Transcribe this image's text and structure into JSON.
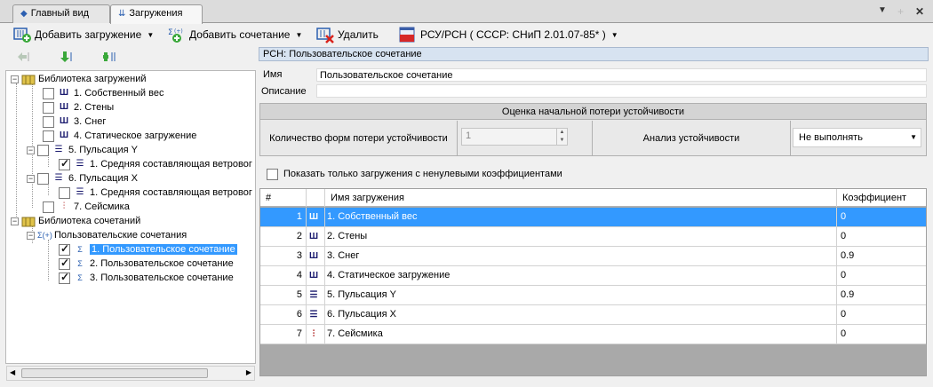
{
  "tabs": [
    {
      "label": "Главный вид",
      "icon": "pin-icon"
    },
    {
      "label": "Загружения",
      "icon": "loads-icon",
      "active": true
    }
  ],
  "tab_controls": {
    "dropdown": "▼",
    "add": "+",
    "close": "✕"
  },
  "toolbar": {
    "add_load": "Добавить загружение",
    "add_combo": "Добавить сочетание",
    "delete": "Удалить",
    "norm": "РСУ/РСН ( СССР: СНиП 2.01.07-85* )"
  },
  "tree": {
    "root_loads": "Библиотека загружений",
    "loads": [
      {
        "label": "1. Собственный вес",
        "icon": "static-load-icon",
        "checked": false
      },
      {
        "label": "2. Стены",
        "icon": "static-load-icon",
        "checked": false
      },
      {
        "label": "3. Снег",
        "icon": "static-load-icon",
        "checked": false
      },
      {
        "label": "4. Статическое загружение",
        "icon": "static-load-icon",
        "checked": false
      },
      {
        "label": "5. Пульсация Y",
        "icon": "pulsation-icon",
        "checked": false,
        "expanded": true,
        "child": {
          "label": "1. Средняя составляющая ветровог",
          "checked": true
        }
      },
      {
        "label": "6. Пульсация X",
        "icon": "pulsation-icon",
        "checked": false,
        "expanded": true,
        "child": {
          "label": "1. Средняя составляющая ветровог",
          "checked": false
        }
      },
      {
        "label": "7. Сейсмика",
        "icon": "seismic-icon",
        "checked": false
      }
    ],
    "root_combos": "Библиотека сочетаний",
    "user_combos_group": "Пользовательские сочетания",
    "combos": [
      {
        "label": "1. Пользовательское сочетание",
        "checked": true,
        "selected": true
      },
      {
        "label": "2. Пользовательское сочетание",
        "checked": true
      },
      {
        "label": "3. Пользовательское сочетание",
        "checked": true
      }
    ]
  },
  "right": {
    "header": "РСН: Пользовательское сочетание",
    "name_label": "Имя",
    "name_value": "Пользовательское сочетание",
    "desc_label": "Описание",
    "desc_value": "",
    "stability": {
      "title": "Оценка начальной потери устойчивости",
      "modes_label": "Количество форм потери устойчивости",
      "modes_value": "1",
      "analysis_label": "Анализ устойчивости",
      "analysis_value": "Не выполнять"
    },
    "filter_label": "Показать только загружения с ненулевыми коэффициентами"
  },
  "grid": {
    "headers": [
      "#",
      "Имя загружения",
      "Коэффициент"
    ],
    "rows": [
      {
        "num": "1",
        "icon": "static-load-icon",
        "name": "1. Собственный вес",
        "coef": "0",
        "selected": true
      },
      {
        "num": "2",
        "icon": "static-load-icon",
        "name": "2. Стены",
        "coef": "0"
      },
      {
        "num": "3",
        "icon": "static-load-icon",
        "name": "3. Снег",
        "coef": "0.9"
      },
      {
        "num": "4",
        "icon": "static-load-icon",
        "name": "4. Статическое загружение",
        "coef": "0"
      },
      {
        "num": "5",
        "icon": "pulsation-icon",
        "name": "5. Пульсация Y",
        "coef": "0.9"
      },
      {
        "num": "6",
        "icon": "pulsation-icon",
        "name": "6. Пульсация X",
        "coef": "0"
      },
      {
        "num": "7",
        "icon": "seismic-icon",
        "name": "7. Сейсмика",
        "coef": "0"
      }
    ]
  },
  "colors": {
    "selection": "#3399ff",
    "header_bg": "#d7e3f1"
  }
}
